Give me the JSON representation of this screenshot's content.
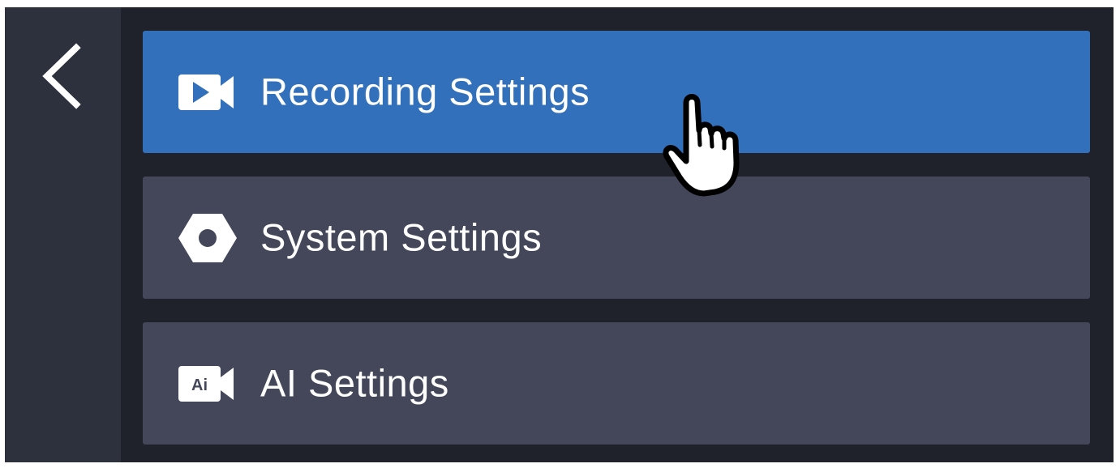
{
  "navigation": {
    "back_icon": "chevron-left-icon"
  },
  "menu": {
    "items": [
      {
        "label": "Recording Settings",
        "icon": "video-camera-icon",
        "selected": true
      },
      {
        "label": "System Settings",
        "icon": "hex-nut-settings-icon",
        "selected": false
      },
      {
        "label": "AI Settings",
        "icon": "ai-camera-icon",
        "icon_text": "Ai",
        "selected": false
      }
    ]
  },
  "colors": {
    "background": "#20222b",
    "side_rail": "#2d303d",
    "item": "#434759",
    "item_selected": "#3270bc",
    "text": "#ffffff"
  },
  "pointer": {
    "icon": "hand-pointer-icon"
  }
}
